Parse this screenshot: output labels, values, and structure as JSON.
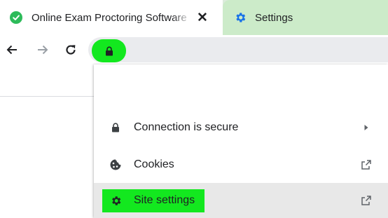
{
  "tabs": [
    {
      "title": "Online Exam Proctoring Software",
      "favicon": "green-check-icon",
      "active": true,
      "close": "✕"
    },
    {
      "title": "Settings",
      "favicon": "gear-icon",
      "active": false
    }
  ],
  "toolbar": {
    "back": "back-arrow-icon",
    "forward": "forward-arrow-icon",
    "reload": "reload-icon",
    "site_info": "lock-icon"
  },
  "site_info_popup": {
    "items": [
      {
        "label": "Connection is secure",
        "icon": "lock-icon",
        "trailing": "chevron-right-icon"
      },
      {
        "label": "Cookies",
        "icon": "cookie-icon",
        "trailing": "external-link-icon"
      },
      {
        "label": "Site settings",
        "icon": "gear-icon",
        "trailing": "external-link-icon",
        "hovered": true
      }
    ]
  },
  "colors": {
    "highlight": "#13e81f",
    "tabstrip": "#ccebc9",
    "favicon_check": "#2dbb5a",
    "settings_gear": "#1a73e8"
  }
}
